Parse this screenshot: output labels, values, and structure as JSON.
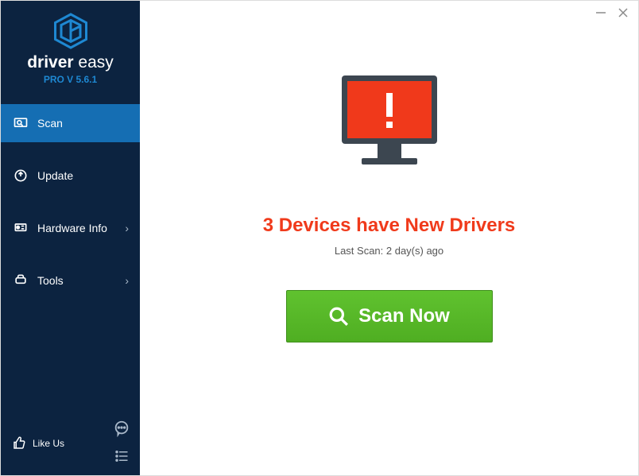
{
  "brand": {
    "word1": "driver",
    "word2": "easy"
  },
  "version": "PRO V 5.6.1",
  "nav": {
    "scan": "Scan",
    "update": "Update",
    "hardware": "Hardware Info",
    "tools": "Tools"
  },
  "likeus": "Like Us",
  "headline": "3 Devices have New Drivers",
  "lastscan": "Last Scan: 2 day(s) ago",
  "scan_label": "Scan Now",
  "colors": {
    "sidebar": "#0c2340",
    "active": "#156eb3",
    "accent_red": "#f03a1b",
    "accent_green": "#55b728"
  }
}
